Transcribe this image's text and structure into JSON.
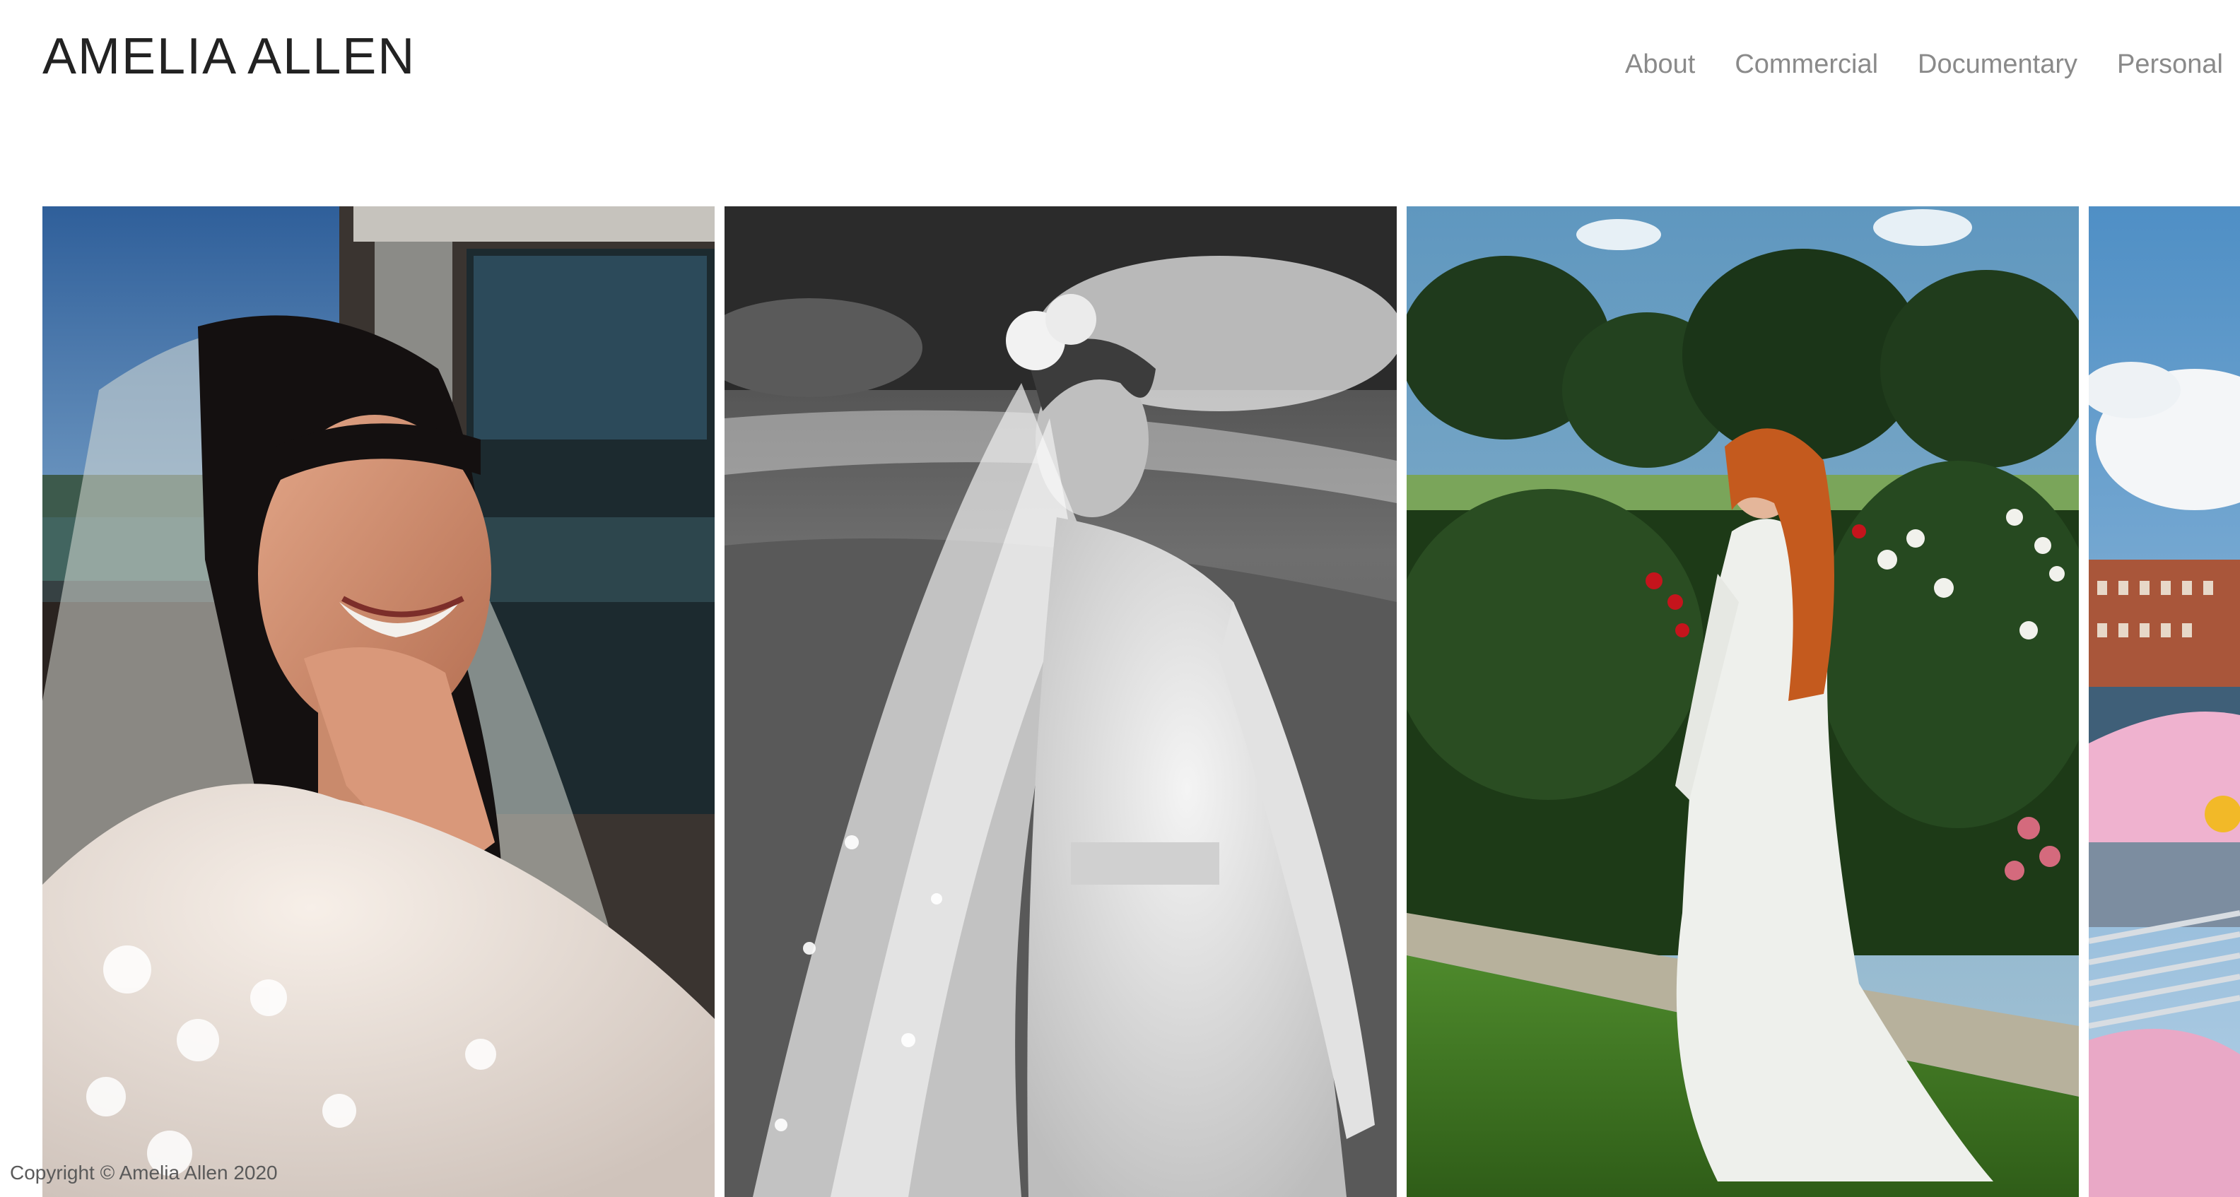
{
  "site": {
    "title": "AMELIA ALLEN"
  },
  "nav": {
    "items": [
      {
        "label": "About"
      },
      {
        "label": "Commercial"
      },
      {
        "label": "Documentary"
      },
      {
        "label": "Personal"
      }
    ]
  },
  "gallery": {
    "photos": [
      {
        "subject": "bride-laughing-lace-veil",
        "tone": "color"
      },
      {
        "subject": "bride-veil-black-and-white",
        "tone": "monochrome"
      },
      {
        "subject": "bride-garden-red-hair",
        "tone": "color"
      },
      {
        "subject": "pink-outfit-riverside",
        "tone": "color"
      }
    ]
  },
  "footer": {
    "copyright": "Copyright © Amelia Allen 2020"
  },
  "colors": {
    "title": "#222222",
    "nav": "#8a8a8a",
    "background": "#ffffff"
  }
}
